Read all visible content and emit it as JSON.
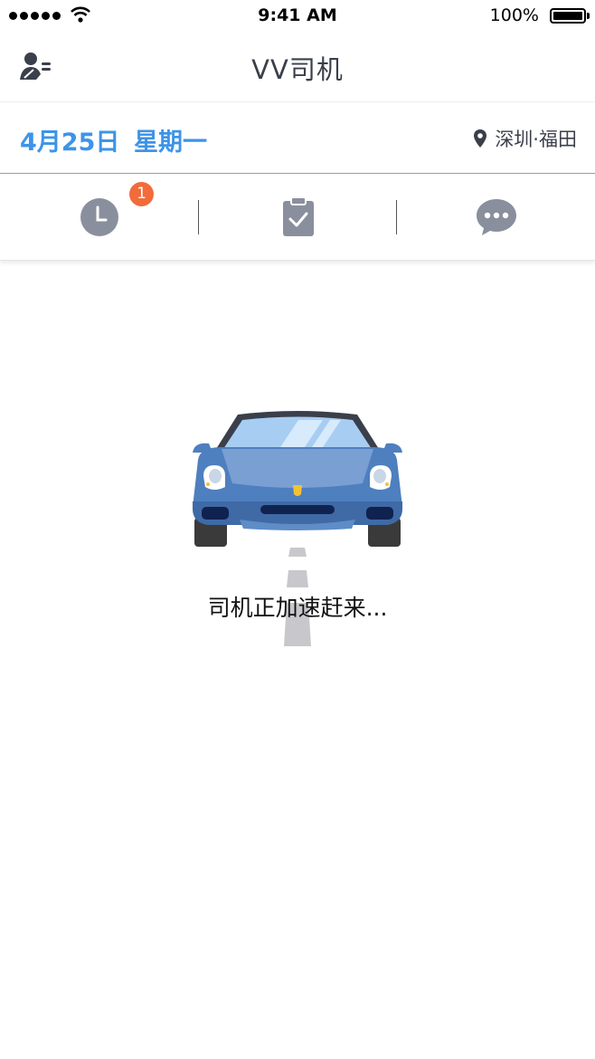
{
  "status_bar": {
    "time": "9:41 AM",
    "battery": "100%",
    "signal_dots": 5
  },
  "nav": {
    "title": "VV司机",
    "profile_icon": "user-list-icon"
  },
  "date_row": {
    "date": "4月25日",
    "weekday": "星期一",
    "location": "深圳·福田",
    "location_icon": "location-pin-icon"
  },
  "tabs": [
    {
      "icon": "clock-icon",
      "badge": "1"
    },
    {
      "icon": "clipboard-check-icon"
    },
    {
      "icon": "chat-bubble-icon"
    }
  ],
  "main": {
    "message": "司机正加速赶来..."
  },
  "colors": {
    "accent": "#3d94e8",
    "badge": "#f26b3a",
    "icon_gray": "#8a8f9e",
    "car_body": "#4e7fbf"
  }
}
